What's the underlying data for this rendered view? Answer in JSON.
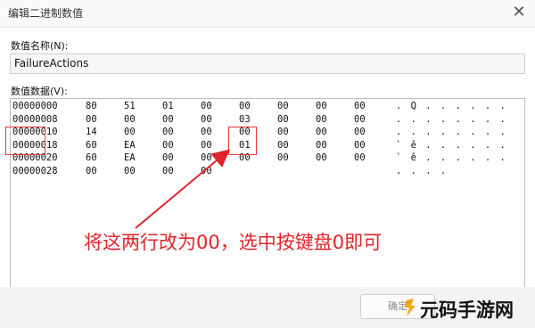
{
  "window": {
    "title": "编辑二进制数值",
    "close_glyph": "✕"
  },
  "value_name": {
    "label": "数值名称(N):",
    "value": "FailureActions"
  },
  "value_data": {
    "label": "数值数据(V):",
    "rows": [
      {
        "addr": "00000000",
        "bytes": [
          "80",
          "51",
          "01",
          "00",
          "00",
          "00",
          "00",
          "00"
        ],
        "ascii": ". Q . . . . . ."
      },
      {
        "addr": "00000008",
        "bytes": [
          "00",
          "00",
          "00",
          "00",
          "03",
          "00",
          "00",
          "00"
        ],
        "ascii": ". . . . . . . ."
      },
      {
        "addr": "00000010",
        "bytes": [
          "14",
          "00",
          "00",
          "00",
          "00",
          "00",
          "00",
          "00"
        ],
        "ascii": ". . . . . . . ."
      },
      {
        "addr": "00000018",
        "bytes": [
          "60",
          "EA",
          "00",
          "00",
          "01",
          "00",
          "00",
          "00"
        ],
        "ascii": "` ê . . . . . ."
      },
      {
        "addr": "00000020",
        "bytes": [
          "60",
          "EA",
          "00",
          "00",
          "00",
          "00",
          "00",
          "00"
        ],
        "ascii": "` ê . . . . . ."
      },
      {
        "addr": "00000028",
        "bytes": [
          "00",
          "00",
          "00",
          "00"
        ],
        "ascii": ". . . ."
      }
    ]
  },
  "annotation": {
    "text": "将这两行改为00，选中按键盘0即可",
    "color": "#e0242a"
  },
  "buttons": {
    "ok": "确定"
  },
  "watermark": {
    "text": "元码手游网"
  }
}
